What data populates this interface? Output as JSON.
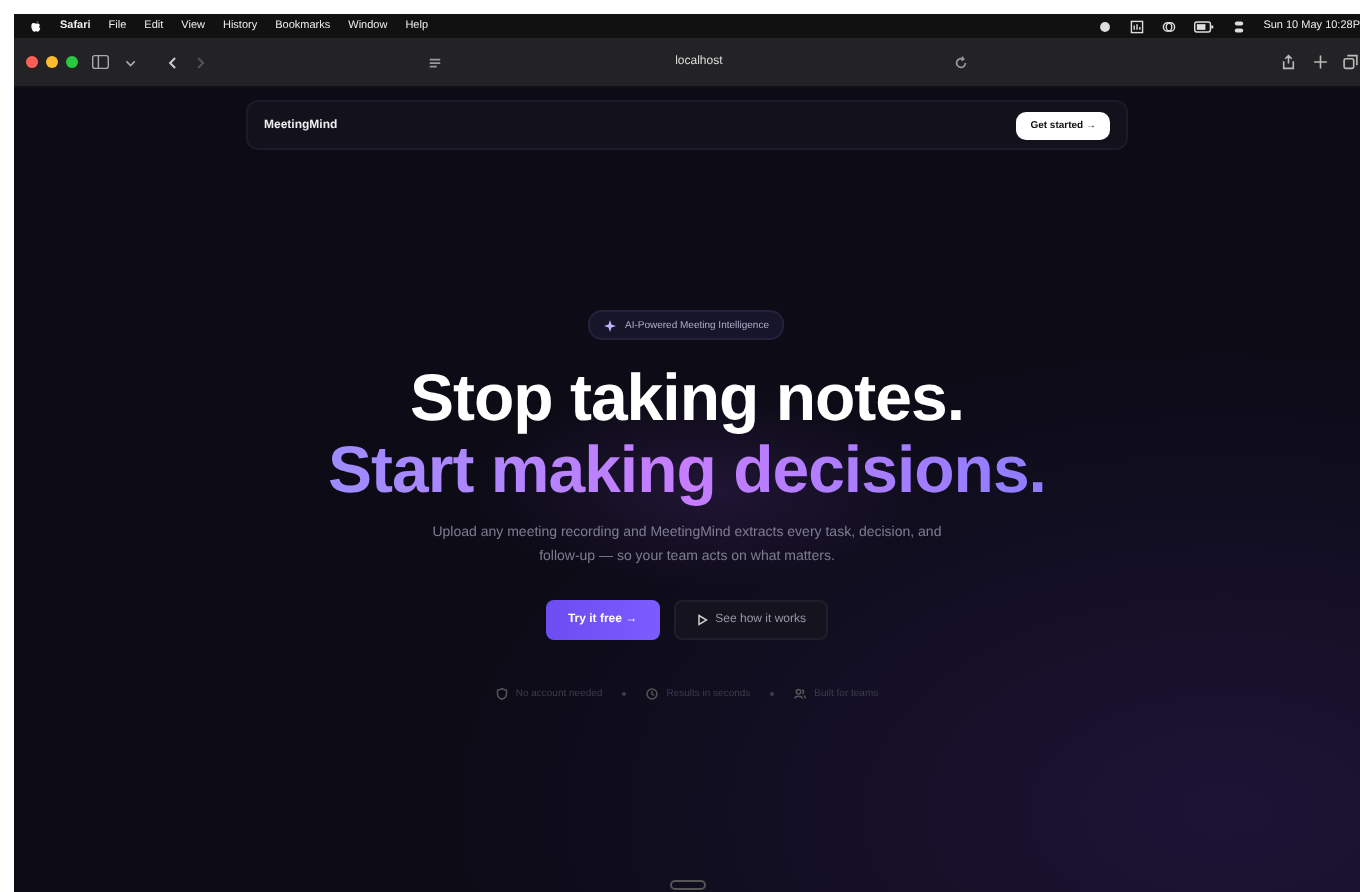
{
  "menu_bar": {
    "app": "Safari",
    "items": [
      "File",
      "Edit",
      "View",
      "History",
      "Bookmarks",
      "Window",
      "Help"
    ],
    "clock": "Sun 10 May 10:28P"
  },
  "browser": {
    "address": "localhost"
  },
  "nav": {
    "brand": "MeetingMind",
    "cta": "Get started →"
  },
  "hero": {
    "badge": "AI-Powered Meeting Intelligence",
    "headline": "Stop taking notes.",
    "headline_accent": "Start making decisions.",
    "description": "Upload any meeting recording and MeetingMind extracts every task, decision, and follow-up — so your team acts on what matters.",
    "primary": "Try it free →",
    "secondary": "See how it works"
  },
  "features": [
    {
      "kind": "shield",
      "label": "No account needed"
    },
    {
      "kind": "clock",
      "label": "Results in seconds"
    },
    {
      "kind": "people",
      "label": "Built for teams"
    }
  ]
}
